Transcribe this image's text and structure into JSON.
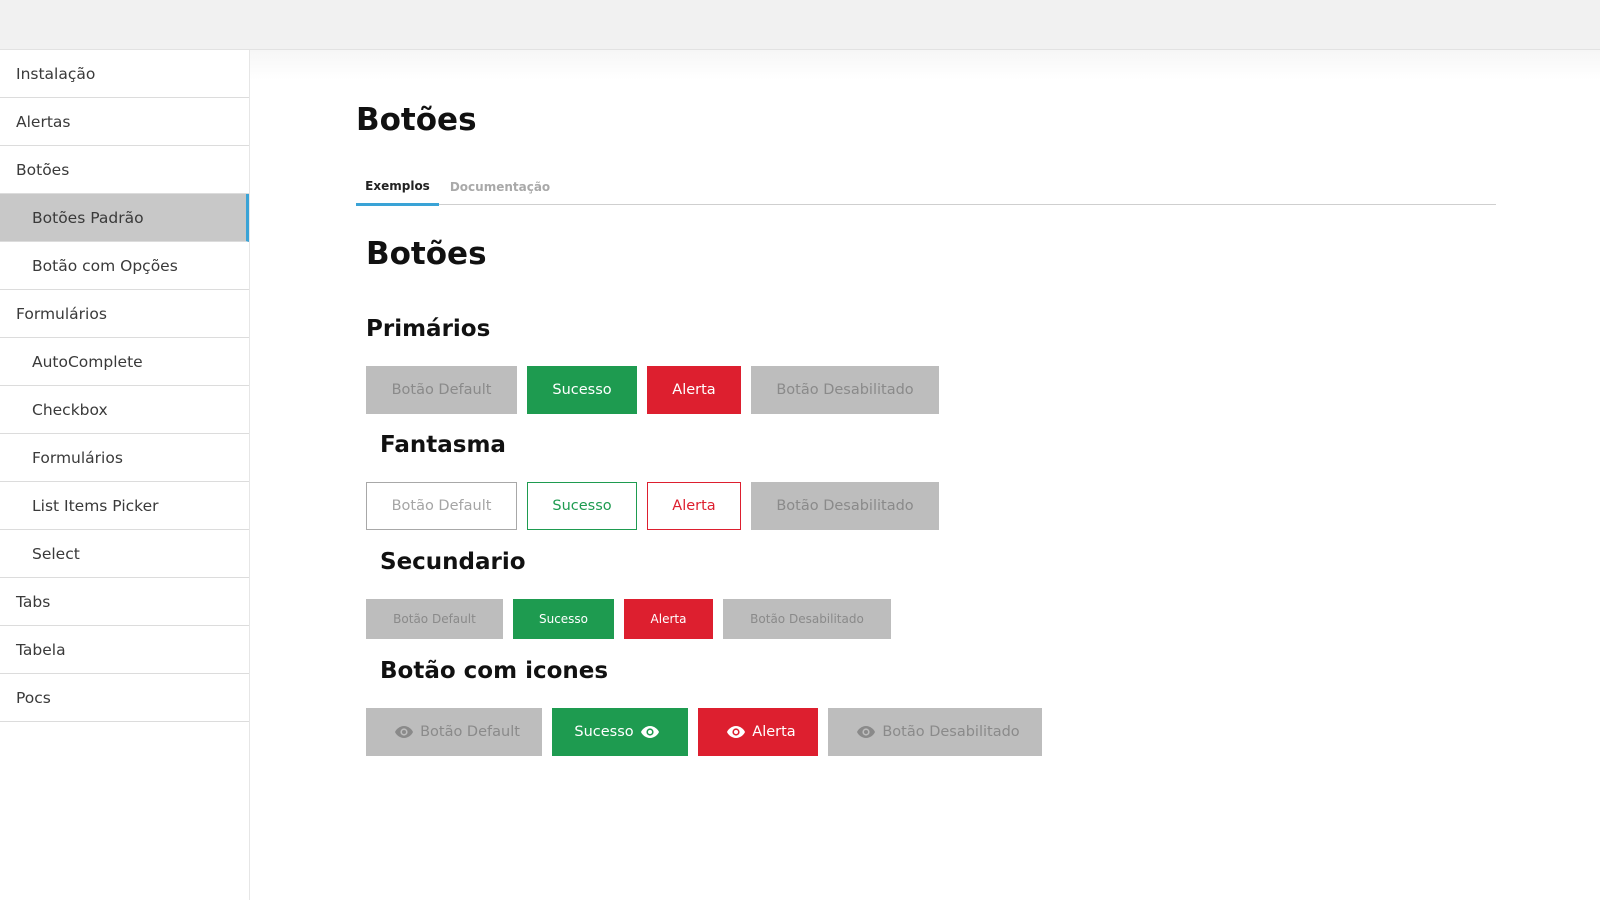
{
  "sidebar": {
    "items": [
      {
        "label": "Instalação"
      },
      {
        "label": "Alertas"
      },
      {
        "label": "Botões"
      },
      {
        "label": "Botões Padrão"
      },
      {
        "label": "Botão com Opções"
      },
      {
        "label": "Formulários"
      },
      {
        "label": "AutoComplete"
      },
      {
        "label": "Checkbox"
      },
      {
        "label": "Formulários"
      },
      {
        "label": "List Items Picker"
      },
      {
        "label": "Select"
      },
      {
        "label": "Tabs"
      },
      {
        "label": "Tabela"
      },
      {
        "label": "Pocs"
      }
    ]
  },
  "page": {
    "title": "Botões",
    "tabs": [
      {
        "label": "Exemplos"
      },
      {
        "label": "Documentação"
      }
    ],
    "section_title": "Botões"
  },
  "groups": {
    "primarios": {
      "title": "Primários",
      "default": "Botão Default",
      "success": "Sucesso",
      "alert": "Alerta",
      "disabled": "Botão Desabilitado"
    },
    "fantasma": {
      "title": "Fantasma",
      "default": "Botão Default",
      "success": "Sucesso",
      "alert": "Alerta",
      "disabled": "Botão Desabilitado"
    },
    "secundario": {
      "title": "Secundario",
      "default": "Botão Default",
      "success": "Sucesso",
      "alert": "Alerta",
      "disabled": "Botão Desabilitado"
    },
    "icones": {
      "title": "Botão com icones",
      "default": "Botão Default",
      "success": "Sucesso",
      "alert": "Alerta",
      "disabled": "Botão Desabilitado",
      "icon": "eye-icon"
    }
  },
  "colors": {
    "accent": "#3aa3d6",
    "success": "#1e9b50",
    "alert": "#dd1f2f",
    "neutral": "#bdbdbd"
  }
}
